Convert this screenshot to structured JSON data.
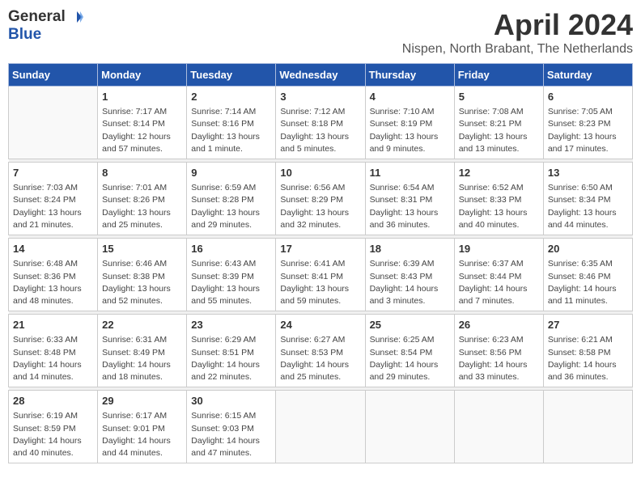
{
  "logo": {
    "general": "General",
    "blue": "Blue"
  },
  "title": "April 2024",
  "subtitle": "Nispen, North Brabant, The Netherlands",
  "days_of_week": [
    "Sunday",
    "Monday",
    "Tuesday",
    "Wednesday",
    "Thursday",
    "Friday",
    "Saturday"
  ],
  "weeks": [
    [
      {
        "day": "",
        "sunrise": "",
        "sunset": "",
        "daylight": ""
      },
      {
        "day": "1",
        "sunrise": "Sunrise: 7:17 AM",
        "sunset": "Sunset: 8:14 PM",
        "daylight": "Daylight: 12 hours and 57 minutes."
      },
      {
        "day": "2",
        "sunrise": "Sunrise: 7:14 AM",
        "sunset": "Sunset: 8:16 PM",
        "daylight": "Daylight: 13 hours and 1 minute."
      },
      {
        "day": "3",
        "sunrise": "Sunrise: 7:12 AM",
        "sunset": "Sunset: 8:18 PM",
        "daylight": "Daylight: 13 hours and 5 minutes."
      },
      {
        "day": "4",
        "sunrise": "Sunrise: 7:10 AM",
        "sunset": "Sunset: 8:19 PM",
        "daylight": "Daylight: 13 hours and 9 minutes."
      },
      {
        "day": "5",
        "sunrise": "Sunrise: 7:08 AM",
        "sunset": "Sunset: 8:21 PM",
        "daylight": "Daylight: 13 hours and 13 minutes."
      },
      {
        "day": "6",
        "sunrise": "Sunrise: 7:05 AM",
        "sunset": "Sunset: 8:23 PM",
        "daylight": "Daylight: 13 hours and 17 minutes."
      }
    ],
    [
      {
        "day": "7",
        "sunrise": "Sunrise: 7:03 AM",
        "sunset": "Sunset: 8:24 PM",
        "daylight": "Daylight: 13 hours and 21 minutes."
      },
      {
        "day": "8",
        "sunrise": "Sunrise: 7:01 AM",
        "sunset": "Sunset: 8:26 PM",
        "daylight": "Daylight: 13 hours and 25 minutes."
      },
      {
        "day": "9",
        "sunrise": "Sunrise: 6:59 AM",
        "sunset": "Sunset: 8:28 PM",
        "daylight": "Daylight: 13 hours and 29 minutes."
      },
      {
        "day": "10",
        "sunrise": "Sunrise: 6:56 AM",
        "sunset": "Sunset: 8:29 PM",
        "daylight": "Daylight: 13 hours and 32 minutes."
      },
      {
        "day": "11",
        "sunrise": "Sunrise: 6:54 AM",
        "sunset": "Sunset: 8:31 PM",
        "daylight": "Daylight: 13 hours and 36 minutes."
      },
      {
        "day": "12",
        "sunrise": "Sunrise: 6:52 AM",
        "sunset": "Sunset: 8:33 PM",
        "daylight": "Daylight: 13 hours and 40 minutes."
      },
      {
        "day": "13",
        "sunrise": "Sunrise: 6:50 AM",
        "sunset": "Sunset: 8:34 PM",
        "daylight": "Daylight: 13 hours and 44 minutes."
      }
    ],
    [
      {
        "day": "14",
        "sunrise": "Sunrise: 6:48 AM",
        "sunset": "Sunset: 8:36 PM",
        "daylight": "Daylight: 13 hours and 48 minutes."
      },
      {
        "day": "15",
        "sunrise": "Sunrise: 6:46 AM",
        "sunset": "Sunset: 8:38 PM",
        "daylight": "Daylight: 13 hours and 52 minutes."
      },
      {
        "day": "16",
        "sunrise": "Sunrise: 6:43 AM",
        "sunset": "Sunset: 8:39 PM",
        "daylight": "Daylight: 13 hours and 55 minutes."
      },
      {
        "day": "17",
        "sunrise": "Sunrise: 6:41 AM",
        "sunset": "Sunset: 8:41 PM",
        "daylight": "Daylight: 13 hours and 59 minutes."
      },
      {
        "day": "18",
        "sunrise": "Sunrise: 6:39 AM",
        "sunset": "Sunset: 8:43 PM",
        "daylight": "Daylight: 14 hours and 3 minutes."
      },
      {
        "day": "19",
        "sunrise": "Sunrise: 6:37 AM",
        "sunset": "Sunset: 8:44 PM",
        "daylight": "Daylight: 14 hours and 7 minutes."
      },
      {
        "day": "20",
        "sunrise": "Sunrise: 6:35 AM",
        "sunset": "Sunset: 8:46 PM",
        "daylight": "Daylight: 14 hours and 11 minutes."
      }
    ],
    [
      {
        "day": "21",
        "sunrise": "Sunrise: 6:33 AM",
        "sunset": "Sunset: 8:48 PM",
        "daylight": "Daylight: 14 hours and 14 minutes."
      },
      {
        "day": "22",
        "sunrise": "Sunrise: 6:31 AM",
        "sunset": "Sunset: 8:49 PM",
        "daylight": "Daylight: 14 hours and 18 minutes."
      },
      {
        "day": "23",
        "sunrise": "Sunrise: 6:29 AM",
        "sunset": "Sunset: 8:51 PM",
        "daylight": "Daylight: 14 hours and 22 minutes."
      },
      {
        "day": "24",
        "sunrise": "Sunrise: 6:27 AM",
        "sunset": "Sunset: 8:53 PM",
        "daylight": "Daylight: 14 hours and 25 minutes."
      },
      {
        "day": "25",
        "sunrise": "Sunrise: 6:25 AM",
        "sunset": "Sunset: 8:54 PM",
        "daylight": "Daylight: 14 hours and 29 minutes."
      },
      {
        "day": "26",
        "sunrise": "Sunrise: 6:23 AM",
        "sunset": "Sunset: 8:56 PM",
        "daylight": "Daylight: 14 hours and 33 minutes."
      },
      {
        "day": "27",
        "sunrise": "Sunrise: 6:21 AM",
        "sunset": "Sunset: 8:58 PM",
        "daylight": "Daylight: 14 hours and 36 minutes."
      }
    ],
    [
      {
        "day": "28",
        "sunrise": "Sunrise: 6:19 AM",
        "sunset": "Sunset: 8:59 PM",
        "daylight": "Daylight: 14 hours and 40 minutes."
      },
      {
        "day": "29",
        "sunrise": "Sunrise: 6:17 AM",
        "sunset": "Sunset: 9:01 PM",
        "daylight": "Daylight: 14 hours and 44 minutes."
      },
      {
        "day": "30",
        "sunrise": "Sunrise: 6:15 AM",
        "sunset": "Sunset: 9:03 PM",
        "daylight": "Daylight: 14 hours and 47 minutes."
      },
      {
        "day": "",
        "sunrise": "",
        "sunset": "",
        "daylight": ""
      },
      {
        "day": "",
        "sunrise": "",
        "sunset": "",
        "daylight": ""
      },
      {
        "day": "",
        "sunrise": "",
        "sunset": "",
        "daylight": ""
      },
      {
        "day": "",
        "sunrise": "",
        "sunset": "",
        "daylight": ""
      }
    ]
  ]
}
